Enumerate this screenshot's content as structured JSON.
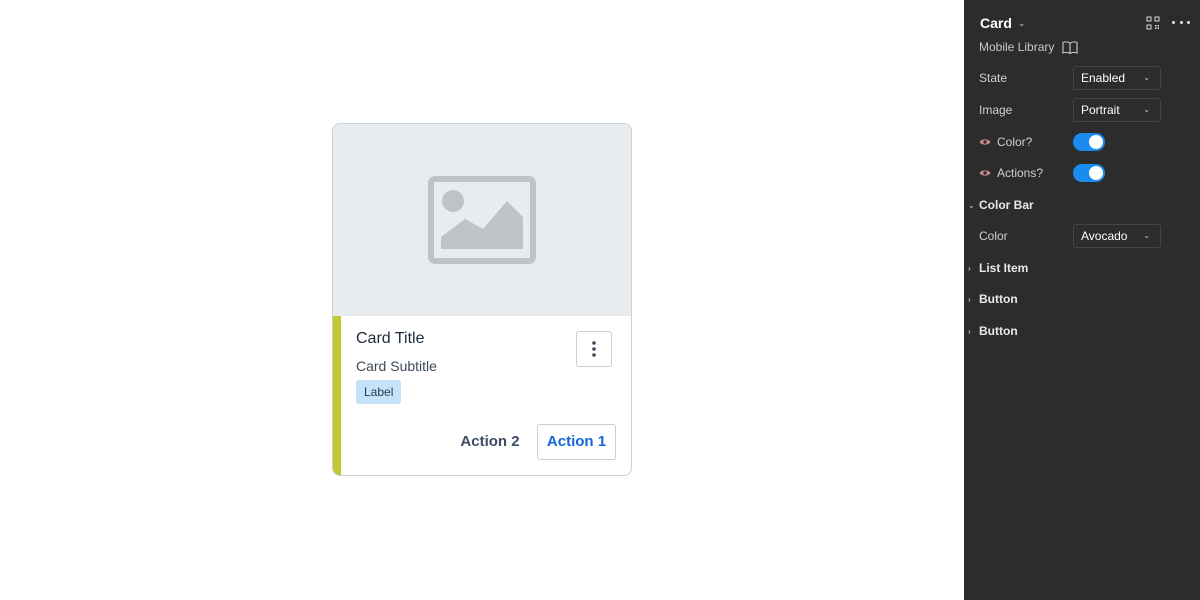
{
  "card": {
    "title": "Card Title",
    "subtitle": "Card Subtitle",
    "label": "Label",
    "action_secondary": "Action 2",
    "action_primary": "Action 1",
    "color_bar_color": "#c1c92e",
    "image_placeholder_icon": "image-placeholder-icon",
    "overflow_icon": "more-vertical-icon"
  },
  "panel": {
    "title": "Card",
    "library": "Mobile Library",
    "properties": [
      {
        "label": "State",
        "value": "Enabled"
      },
      {
        "label": "Image",
        "value": "Portrait"
      }
    ],
    "toggles": [
      {
        "label": "Color?",
        "on": true
      },
      {
        "label": "Actions?",
        "on": true
      }
    ],
    "color_bar_section": "Color Bar",
    "color_prop": {
      "label": "Color",
      "value": "Avocado"
    },
    "sections": [
      "List Item",
      "Button",
      "Button"
    ]
  },
  "colors": {
    "panel_bg": "#2c2c2c",
    "toggle_on": "#1a8cf0",
    "primary_action": "#1565d8",
    "label_bg": "#c4e3f8"
  }
}
